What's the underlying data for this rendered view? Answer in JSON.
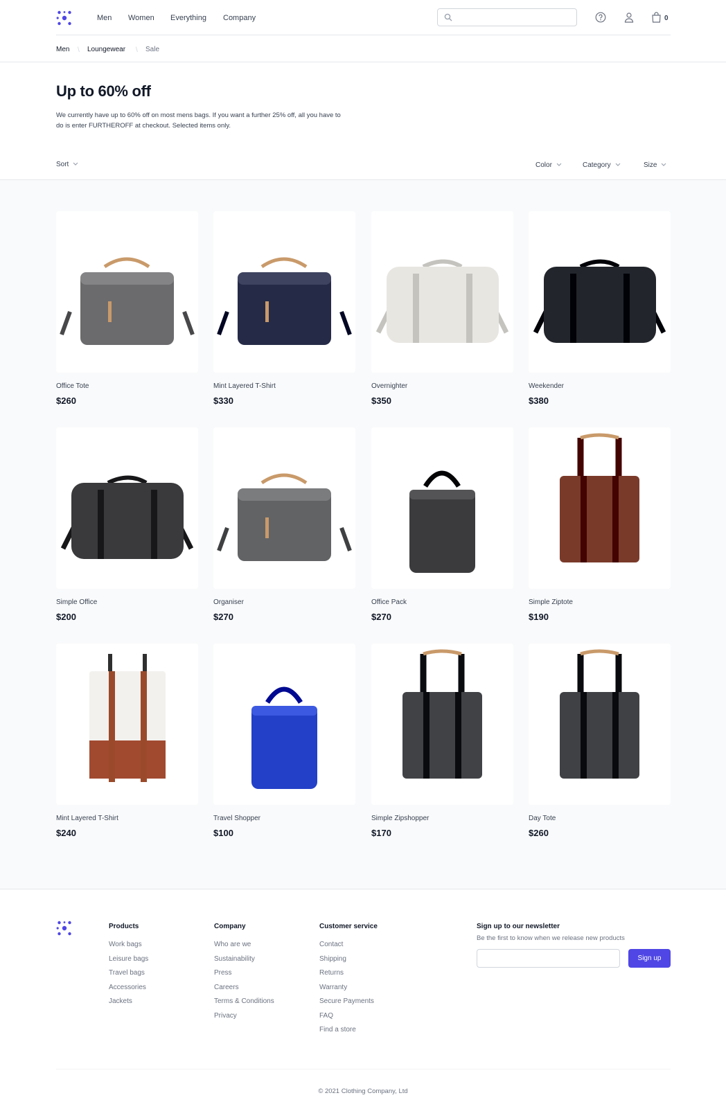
{
  "brand": {
    "accent": "#4f46e5"
  },
  "header": {
    "nav": [
      "Men",
      "Women",
      "Everything",
      "Company"
    ],
    "search_placeholder": "",
    "cart_count": "0",
    "icons": [
      "search-icon",
      "help-icon",
      "user-icon",
      "shopping-bag-icon"
    ]
  },
  "breadcrumb": [
    "Men",
    "Loungewear",
    "Sale"
  ],
  "hero": {
    "title": "Up to 60% off",
    "description": "We currently have up to 60% off on most mens bags. If you want a further 25% off, all you have to do is enter FURTHEROFF at checkout. Selected items only."
  },
  "filters": {
    "sort": "Sort",
    "options": [
      "Color",
      "Category",
      "Size"
    ]
  },
  "products": [
    {
      "name": "Office Tote",
      "price": "$260",
      "color": "#6b6b6d"
    },
    {
      "name": "Mint Layered T-Shirt",
      "price": "$330",
      "color": "#252a47"
    },
    {
      "name": "Overnighter",
      "price": "$350",
      "color": "#e8e6e1"
    },
    {
      "name": "Weekender",
      "price": "$380",
      "color": "#22252b"
    },
    {
      "name": "Simple Office",
      "price": "$200",
      "color": "#3a3a3c"
    },
    {
      "name": "Organiser",
      "price": "$270",
      "color": "#626365"
    },
    {
      "name": "Office Pack",
      "price": "$270",
      "color": "#3b3b3d"
    },
    {
      "name": "Simple Ziptote",
      "price": "$190",
      "color": "#7a3a2a"
    },
    {
      "name": "Mint Layered T-Shirt",
      "price": "$240",
      "color": "#f2f1ee"
    },
    {
      "name": "Travel Shopper",
      "price": "$100",
      "color": "#2340c8"
    },
    {
      "name": "Simple Zipshopper",
      "price": "$170",
      "color": "#404246"
    },
    {
      "name": "Day Tote",
      "price": "$260",
      "color": "#404144"
    }
  ],
  "footer": {
    "columns": [
      {
        "title": "Products",
        "links": [
          "Work bags",
          "Leisure bags",
          "Travel bags",
          "Accessories",
          "Jackets"
        ]
      },
      {
        "title": "Company",
        "links": [
          "Who are we",
          "Sustainability",
          "Press",
          "Careers",
          "Terms & Conditions",
          "Privacy"
        ]
      },
      {
        "title": "Customer service",
        "links": [
          "Contact",
          "Shipping",
          "Returns",
          "Warranty",
          "Secure Payments",
          "FAQ",
          "Find a store"
        ]
      }
    ],
    "newsletter": {
      "title": "Sign up to our newsletter",
      "subtitle": "Be the first to know when we release new products",
      "button": "Sign up",
      "placeholder": ""
    },
    "copyright": "© 2021 Clothing Company, Ltd"
  }
}
